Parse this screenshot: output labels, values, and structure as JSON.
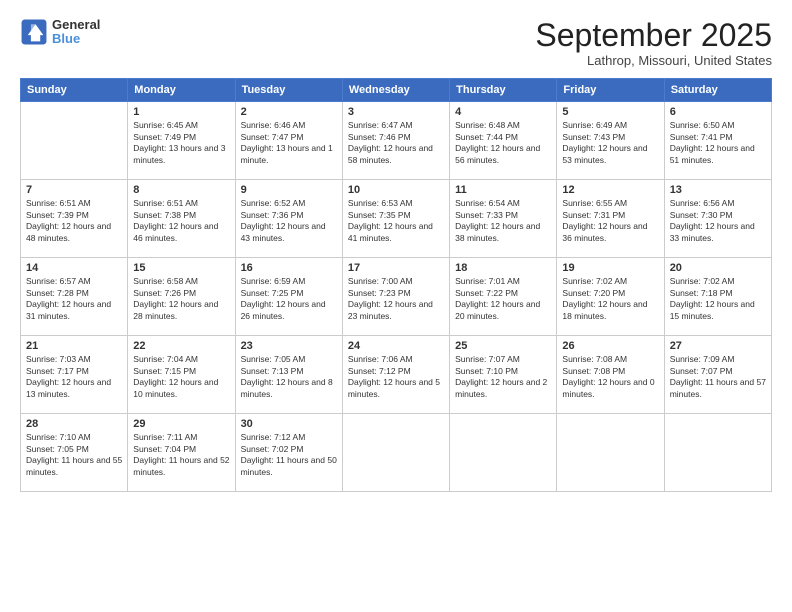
{
  "header": {
    "logo_line1": "General",
    "logo_line2": "Blue",
    "month": "September 2025",
    "location": "Lathrop, Missouri, United States"
  },
  "weekdays": [
    "Sunday",
    "Monday",
    "Tuesday",
    "Wednesday",
    "Thursday",
    "Friday",
    "Saturday"
  ],
  "weeks": [
    [
      {
        "day": "",
        "sunrise": "",
        "sunset": "",
        "daylight": ""
      },
      {
        "day": "1",
        "sunrise": "Sunrise: 6:45 AM",
        "sunset": "Sunset: 7:49 PM",
        "daylight": "Daylight: 13 hours and 3 minutes."
      },
      {
        "day": "2",
        "sunrise": "Sunrise: 6:46 AM",
        "sunset": "Sunset: 7:47 PM",
        "daylight": "Daylight: 13 hours and 1 minute."
      },
      {
        "day": "3",
        "sunrise": "Sunrise: 6:47 AM",
        "sunset": "Sunset: 7:46 PM",
        "daylight": "Daylight: 12 hours and 58 minutes."
      },
      {
        "day": "4",
        "sunrise": "Sunrise: 6:48 AM",
        "sunset": "Sunset: 7:44 PM",
        "daylight": "Daylight: 12 hours and 56 minutes."
      },
      {
        "day": "5",
        "sunrise": "Sunrise: 6:49 AM",
        "sunset": "Sunset: 7:43 PM",
        "daylight": "Daylight: 12 hours and 53 minutes."
      },
      {
        "day": "6",
        "sunrise": "Sunrise: 6:50 AM",
        "sunset": "Sunset: 7:41 PM",
        "daylight": "Daylight: 12 hours and 51 minutes."
      }
    ],
    [
      {
        "day": "7",
        "sunrise": "Sunrise: 6:51 AM",
        "sunset": "Sunset: 7:39 PM",
        "daylight": "Daylight: 12 hours and 48 minutes."
      },
      {
        "day": "8",
        "sunrise": "Sunrise: 6:51 AM",
        "sunset": "Sunset: 7:38 PM",
        "daylight": "Daylight: 12 hours and 46 minutes."
      },
      {
        "day": "9",
        "sunrise": "Sunrise: 6:52 AM",
        "sunset": "Sunset: 7:36 PM",
        "daylight": "Daylight: 12 hours and 43 minutes."
      },
      {
        "day": "10",
        "sunrise": "Sunrise: 6:53 AM",
        "sunset": "Sunset: 7:35 PM",
        "daylight": "Daylight: 12 hours and 41 minutes."
      },
      {
        "day": "11",
        "sunrise": "Sunrise: 6:54 AM",
        "sunset": "Sunset: 7:33 PM",
        "daylight": "Daylight: 12 hours and 38 minutes."
      },
      {
        "day": "12",
        "sunrise": "Sunrise: 6:55 AM",
        "sunset": "Sunset: 7:31 PM",
        "daylight": "Daylight: 12 hours and 36 minutes."
      },
      {
        "day": "13",
        "sunrise": "Sunrise: 6:56 AM",
        "sunset": "Sunset: 7:30 PM",
        "daylight": "Daylight: 12 hours and 33 minutes."
      }
    ],
    [
      {
        "day": "14",
        "sunrise": "Sunrise: 6:57 AM",
        "sunset": "Sunset: 7:28 PM",
        "daylight": "Daylight: 12 hours and 31 minutes."
      },
      {
        "day": "15",
        "sunrise": "Sunrise: 6:58 AM",
        "sunset": "Sunset: 7:26 PM",
        "daylight": "Daylight: 12 hours and 28 minutes."
      },
      {
        "day": "16",
        "sunrise": "Sunrise: 6:59 AM",
        "sunset": "Sunset: 7:25 PM",
        "daylight": "Daylight: 12 hours and 26 minutes."
      },
      {
        "day": "17",
        "sunrise": "Sunrise: 7:00 AM",
        "sunset": "Sunset: 7:23 PM",
        "daylight": "Daylight: 12 hours and 23 minutes."
      },
      {
        "day": "18",
        "sunrise": "Sunrise: 7:01 AM",
        "sunset": "Sunset: 7:22 PM",
        "daylight": "Daylight: 12 hours and 20 minutes."
      },
      {
        "day": "19",
        "sunrise": "Sunrise: 7:02 AM",
        "sunset": "Sunset: 7:20 PM",
        "daylight": "Daylight: 12 hours and 18 minutes."
      },
      {
        "day": "20",
        "sunrise": "Sunrise: 7:02 AM",
        "sunset": "Sunset: 7:18 PM",
        "daylight": "Daylight: 12 hours and 15 minutes."
      }
    ],
    [
      {
        "day": "21",
        "sunrise": "Sunrise: 7:03 AM",
        "sunset": "Sunset: 7:17 PM",
        "daylight": "Daylight: 12 hours and 13 minutes."
      },
      {
        "day": "22",
        "sunrise": "Sunrise: 7:04 AM",
        "sunset": "Sunset: 7:15 PM",
        "daylight": "Daylight: 12 hours and 10 minutes."
      },
      {
        "day": "23",
        "sunrise": "Sunrise: 7:05 AM",
        "sunset": "Sunset: 7:13 PM",
        "daylight": "Daylight: 12 hours and 8 minutes."
      },
      {
        "day": "24",
        "sunrise": "Sunrise: 7:06 AM",
        "sunset": "Sunset: 7:12 PM",
        "daylight": "Daylight: 12 hours and 5 minutes."
      },
      {
        "day": "25",
        "sunrise": "Sunrise: 7:07 AM",
        "sunset": "Sunset: 7:10 PM",
        "daylight": "Daylight: 12 hours and 2 minutes."
      },
      {
        "day": "26",
        "sunrise": "Sunrise: 7:08 AM",
        "sunset": "Sunset: 7:08 PM",
        "daylight": "Daylight: 12 hours and 0 minutes."
      },
      {
        "day": "27",
        "sunrise": "Sunrise: 7:09 AM",
        "sunset": "Sunset: 7:07 PM",
        "daylight": "Daylight: 11 hours and 57 minutes."
      }
    ],
    [
      {
        "day": "28",
        "sunrise": "Sunrise: 7:10 AM",
        "sunset": "Sunset: 7:05 PM",
        "daylight": "Daylight: 11 hours and 55 minutes."
      },
      {
        "day": "29",
        "sunrise": "Sunrise: 7:11 AM",
        "sunset": "Sunset: 7:04 PM",
        "daylight": "Daylight: 11 hours and 52 minutes."
      },
      {
        "day": "30",
        "sunrise": "Sunrise: 7:12 AM",
        "sunset": "Sunset: 7:02 PM",
        "daylight": "Daylight: 11 hours and 50 minutes."
      },
      {
        "day": "",
        "sunrise": "",
        "sunset": "",
        "daylight": ""
      },
      {
        "day": "",
        "sunrise": "",
        "sunset": "",
        "daylight": ""
      },
      {
        "day": "",
        "sunrise": "",
        "sunset": "",
        "daylight": ""
      },
      {
        "day": "",
        "sunrise": "",
        "sunset": "",
        "daylight": ""
      }
    ]
  ]
}
